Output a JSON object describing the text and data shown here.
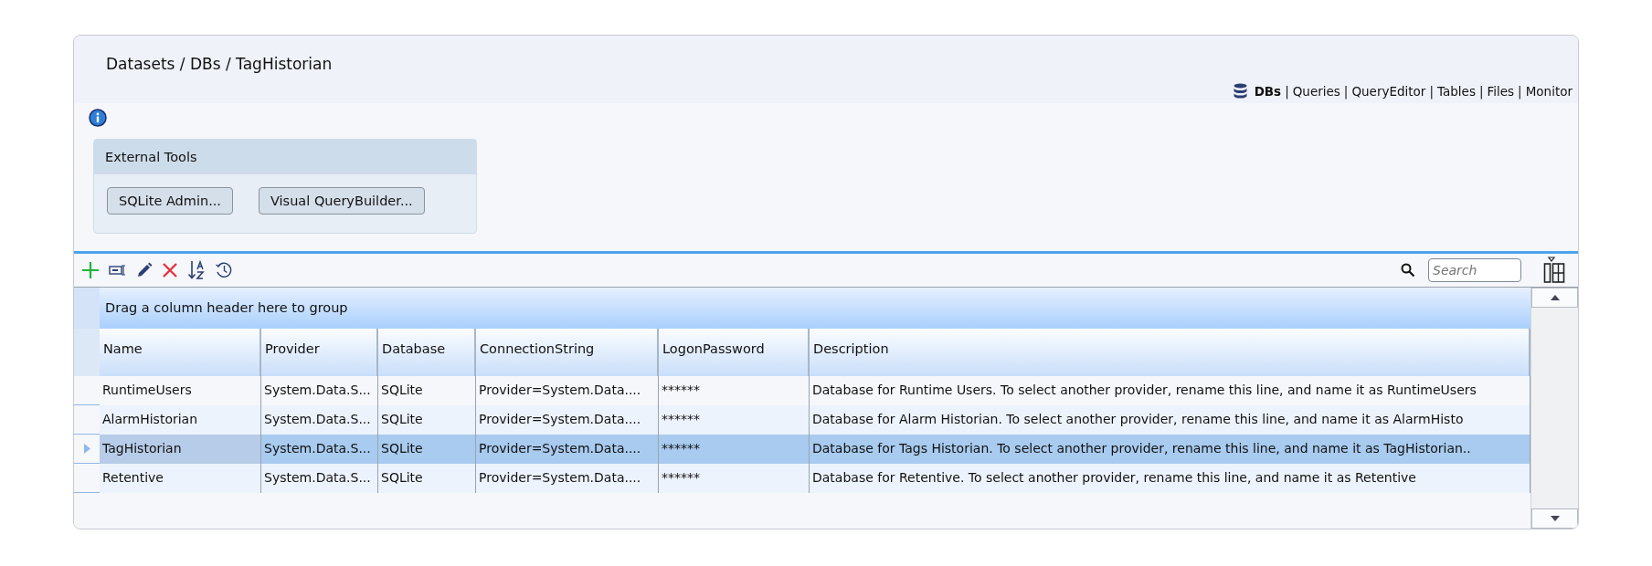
{
  "breadcrumb": "Datasets / DBs / TagHistorian",
  "nav": {
    "separator": "|",
    "items": [
      {
        "label": "DBs",
        "selected": true
      },
      {
        "label": "Queries",
        "selected": false
      },
      {
        "label": "QueryEditor",
        "selected": false
      },
      {
        "label": "Tables",
        "selected": false
      },
      {
        "label": "Files",
        "selected": false
      },
      {
        "label": "Monitor",
        "selected": false
      }
    ]
  },
  "external_tools": {
    "title": "External Tools",
    "buttons": [
      "SQLite Admin...",
      "Visual QueryBuilder..."
    ]
  },
  "search": {
    "placeholder": "Search"
  },
  "grid": {
    "group_panel": "Drag a column header here to group",
    "columns": [
      "Name",
      "Provider",
      "Database",
      "ConnectionString",
      "LogonPassword",
      "Description"
    ],
    "rows": [
      {
        "selected": false,
        "cells": [
          "RuntimeUsers",
          "System.Data.S...",
          "SQLite",
          "Provider=System.Data....",
          "******",
          "Database for Runtime Users.  To select another provider, rename this line, and name it as RuntimeUsers"
        ]
      },
      {
        "selected": false,
        "cells": [
          "AlarmHistorian",
          "System.Data.S...",
          "SQLite",
          "Provider=System.Data....",
          "******",
          "Database for Alarm Historian.  To select another provider, rename this line, and name it as AlarmHisto"
        ]
      },
      {
        "selected": true,
        "cells": [
          "TagHistorian",
          "System.Data.S...",
          "SQLite",
          "Provider=System.Data....",
          "******",
          "Database for Tags Historian. To select another provider, rename this line, and name it as TagHistorian.."
        ]
      },
      {
        "selected": false,
        "cells": [
          "Retentive",
          "System.Data.S...",
          "SQLite",
          "Provider=System.Data....",
          "******",
          "Database for Retentive. To select another provider, rename this line, and name it as Retentive"
        ]
      }
    ]
  }
}
